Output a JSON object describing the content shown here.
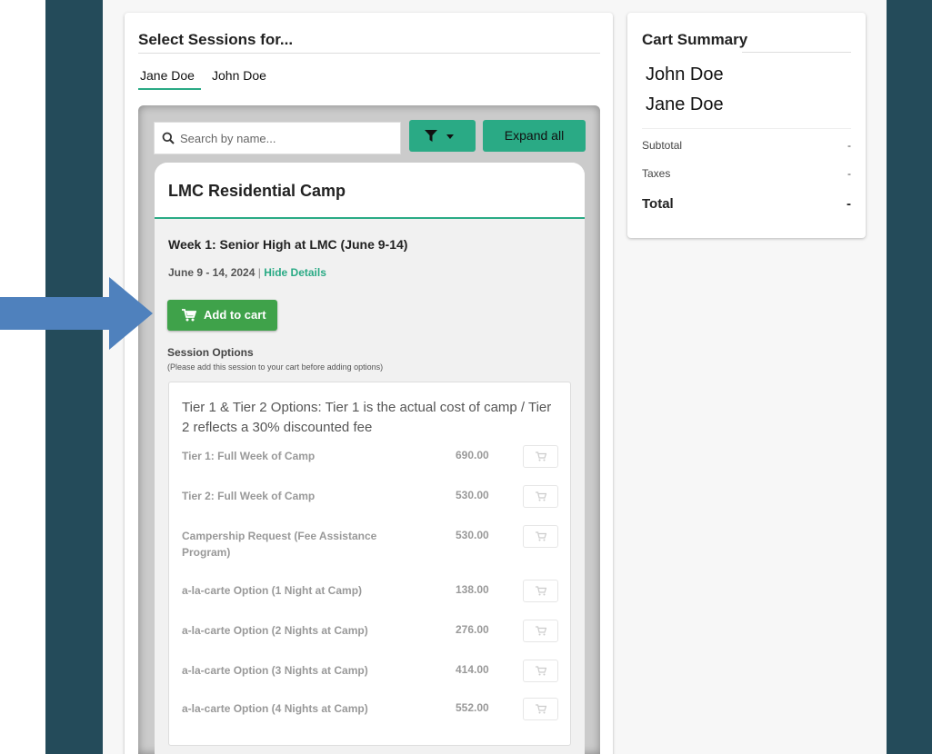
{
  "colors": {
    "frame": "#244b5a",
    "accent": "#2aaa85",
    "add_button": "#3fa24a",
    "arrow": "#4f81bd"
  },
  "sessions": {
    "title": "Select Sessions for...",
    "people": [
      "Jane Doe",
      "John Doe"
    ],
    "active_person": "Jane Doe"
  },
  "toolbar": {
    "search_placeholder": "Search by name...",
    "filter_icon": "filter-icon",
    "expand_label": "Expand all"
  },
  "camp": {
    "title": "LMC Residential Camp",
    "week": {
      "title": "Week 1: Senior High at LMC (June 9-14)",
      "dates": "June 9 - 14, 2024",
      "separator": "|",
      "details_link": "Hide Details",
      "add_to_cart": "Add to cart"
    },
    "options": {
      "title": "Session Options",
      "note": "(Please add this session to your cart before adding options)",
      "heading": "Tier 1 & Tier 2 Options: Tier 1 is the actual cost of camp / Tier 2 reflects a 30% discounted fee",
      "items": [
        {
          "label": "Tier 1: Full Week of Camp",
          "price": "690.00"
        },
        {
          "label": "Tier 2: Full Week of Camp",
          "price": "530.00"
        },
        {
          "label": "Campership Request (Fee Assistance Program)",
          "price": "530.00"
        },
        {
          "label": "a-la-carte Option (1 Night at Camp)",
          "price": "138.00"
        },
        {
          "label": "a-la-carte Option (2 Nights at Camp)",
          "price": "276.00"
        },
        {
          "label": "a-la-carte Option (3 Nights at Camp)",
          "price": "414.00"
        },
        {
          "label": "a-la-carte Option (4 Nights at Camp)",
          "price": "552.00"
        }
      ]
    }
  },
  "cart": {
    "title": "Cart Summary",
    "names": [
      "John Doe",
      "Jane Doe"
    ],
    "subtotal_label": "Subtotal",
    "subtotal_value": "-",
    "taxes_label": "Taxes",
    "taxes_value": "-",
    "total_label": "Total",
    "total_value": "-"
  }
}
